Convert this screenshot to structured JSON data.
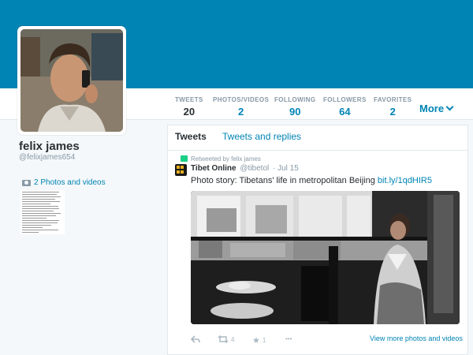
{
  "profile": {
    "name": "felix james",
    "handle": "@felixjames654",
    "photos_link": "2 Photos and videos"
  },
  "stats": [
    {
      "label": "TWEETS",
      "value": "20"
    },
    {
      "label": "PHOTOS/VIDEOS",
      "value": "2"
    },
    {
      "label": "FOLLOWING",
      "value": "90"
    },
    {
      "label": "FOLLOWERS",
      "value": "64"
    },
    {
      "label": "FAVORITES",
      "value": "2"
    }
  ],
  "more_label": "More",
  "tabs": {
    "tweets": "Tweets",
    "replies": "Tweets and replies"
  },
  "tweet": {
    "retweeted_by": "Retweeted by felix james",
    "author_name": "Tibet Online",
    "author_handle": "@tibetol",
    "date": "· Jul 15",
    "text": "Photo story: Tibetans' life in metropolitan Beijing",
    "link": "bit.ly/1qdHIR5",
    "retweet_count": "4",
    "favorite_count": "1",
    "more_dots": "•••"
  },
  "view_more": "View more photos and videos",
  "colors": {
    "brand": "#0084b4",
    "retweet": "#19cf86"
  }
}
